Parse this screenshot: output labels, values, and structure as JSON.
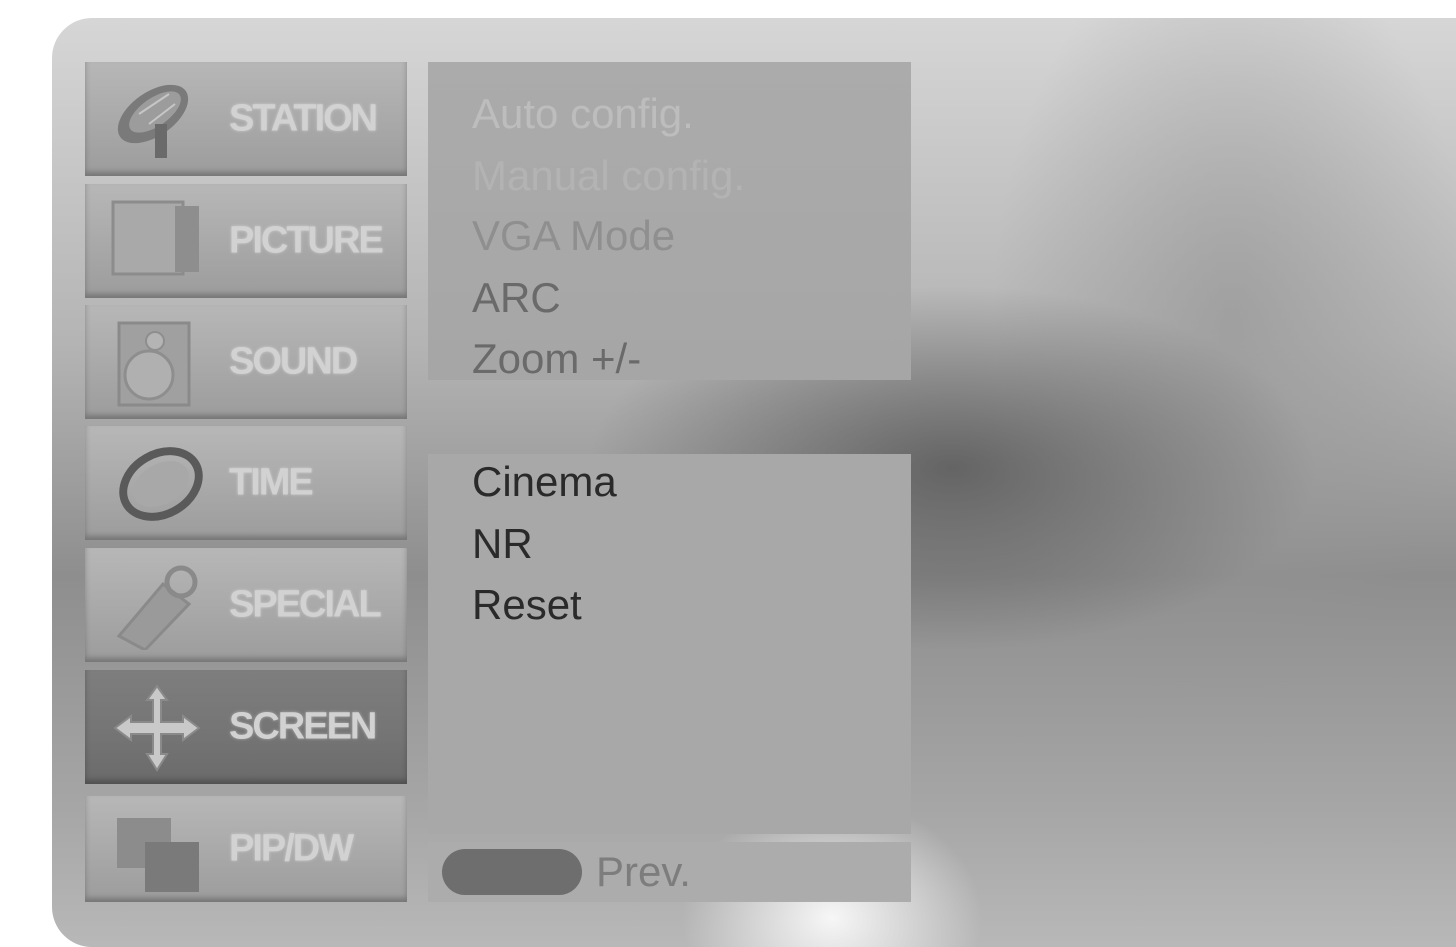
{
  "menu": {
    "items": [
      {
        "label": "STATION",
        "icon": "satellite-dish-icon",
        "selected": false
      },
      {
        "label": "PICTURE",
        "icon": "picture-screen-icon",
        "selected": false
      },
      {
        "label": "SOUND",
        "icon": "speaker-icon",
        "selected": false
      },
      {
        "label": "TIME",
        "icon": "clock-ring-icon",
        "selected": false
      },
      {
        "label": "SPECIAL",
        "icon": "key-tag-icon",
        "selected": false
      },
      {
        "label": "SCREEN",
        "icon": "move-arrows-icon",
        "selected": true
      },
      {
        "label": "PIP/DW",
        "icon": "pip-screens-icon",
        "selected": false
      }
    ]
  },
  "submenu_top": {
    "items": [
      "Auto config.",
      "Manual config.",
      "VGA Mode",
      "ARC",
      "Zoom +/-"
    ]
  },
  "submenu_bottom": {
    "items": [
      "Cinema",
      "NR",
      "Reset"
    ]
  },
  "footer": {
    "prev_label": "Prev.",
    "key_icon": "blue-button-icon"
  }
}
